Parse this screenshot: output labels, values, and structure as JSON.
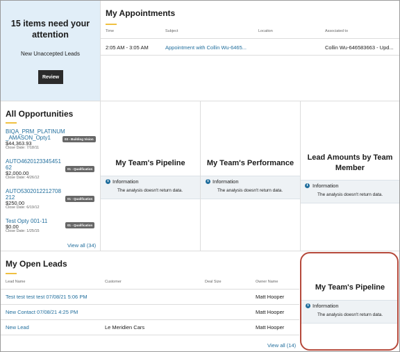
{
  "attention": {
    "title": "15 items need your attention",
    "subtitle": "New Unaccepted Leads",
    "review_label": "Review"
  },
  "appointments": {
    "title": "My Appointments",
    "columns": [
      "Time",
      "Subject",
      "Location",
      "Associated to"
    ],
    "rows": [
      {
        "time": "2:05 AM - 3:05 AM",
        "subject": "Appointment with Collin Wu-6465...",
        "location": "",
        "associated": "Collin Wu-646583663 - Upd..."
      }
    ]
  },
  "opportunities": {
    "title": "All Opportunities",
    "items": [
      {
        "name_line1": "BIQA_PRM_PLATINUM",
        "name_line2": "_AMASON_Opty1",
        "amount": "$44,363.93",
        "close_date": "Close Date: 7/18/11",
        "badge": "03 - Building Vision"
      },
      {
        "name_line1": "AUTO4620123345451",
        "name_line2": "62",
        "amount": "$2,000.00",
        "close_date": "Close Date: 4/26/12",
        "badge": "01 - Qualification"
      },
      {
        "name_line1": "AUTO5302012212708",
        "name_line2": "212",
        "amount": "$250.00",
        "close_date": "Close Date: 6/19/12",
        "badge": "01 - Qualification"
      },
      {
        "name_line1": "Test Opty 001-11",
        "name_line2": "",
        "amount": "$0.00",
        "close_date": "Close Date: 1/25/15",
        "badge": "01 - Qualification"
      }
    ],
    "view_all": "View all (34)"
  },
  "tiles": {
    "pipeline": {
      "title": "My Team's Pipeline",
      "info": "Information",
      "message": "The analysis doesn't return data."
    },
    "performance": {
      "title": "My Team's Performance",
      "info": "Information",
      "message": "The analysis doesn't return data."
    },
    "lead_amounts": {
      "title": "Lead Amounts by Team Member",
      "info": "Information",
      "message": "The analysis doesn't return data."
    },
    "pipeline2": {
      "title": "My Team's Pipeline",
      "info": "Information",
      "message": "The analysis doesn't return data."
    }
  },
  "leads": {
    "title": "My Open Leads",
    "columns": [
      "Lead Name",
      "Customer",
      "Deal Size",
      "Owner Name"
    ],
    "rows": [
      {
        "name": "Test test test test 07/08/21 5:06 PM",
        "customer": "",
        "deal_size": "",
        "owner": "Matt Hooper"
      },
      {
        "name": "New Contact 07/08/21 4:25 PM",
        "customer": "",
        "deal_size": "",
        "owner": "Matt Hooper"
      },
      {
        "name": "New Lead",
        "customer": "Le Meridien Cars",
        "deal_size": "",
        "owner": "Matt Hooper"
      }
    ],
    "view_all": "View all (14)"
  },
  "icons": {
    "info": "info-icon"
  },
  "colors": {
    "accent": "#f0c040",
    "link": "#1f6d9c",
    "highlight": "#b5483a",
    "attention_bg": "#e1eef8"
  }
}
